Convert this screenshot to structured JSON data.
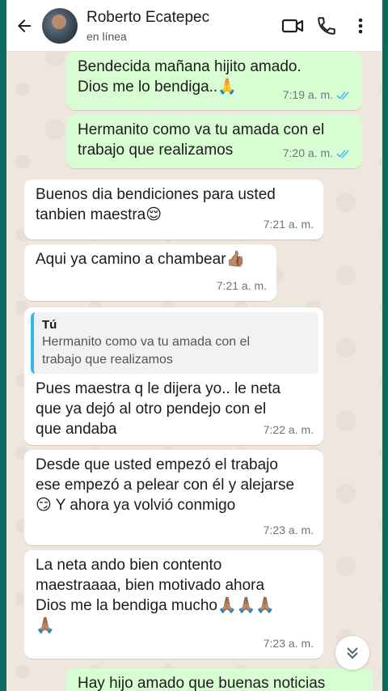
{
  "header": {
    "contact_name": "Roberto Ecatepec",
    "status": "en línea"
  },
  "icons": {
    "back": "arrow-left-icon",
    "video": "video-call-icon",
    "call": "phone-icon",
    "menu": "more-vert-icon",
    "read_receipt": "double-check-icon",
    "scroll_down": "chevron-double-down-icon"
  },
  "colors": {
    "outgoing_bubble": "#d9fdd3",
    "incoming_bubble": "#ffffff",
    "read_tick": "#53bdeb",
    "quote_bar": "#34b7f1"
  },
  "messages": [
    {
      "direction": "out",
      "text": "Bendecida mañana hijito amado.\nDios me lo bendiga..🙏",
      "time": "7:19 a. m.",
      "read": true
    },
    {
      "direction": "out",
      "text": "Hermanito como va tu amada con el\ntrabajo que realizamos",
      "time": "7:20 a. m.",
      "read": true
    },
    {
      "direction": "in",
      "text": "Buenos dia bendiciones para usted\ntanbien maestra😌",
      "time": "7:21 a. m."
    },
    {
      "direction": "in",
      "text": "Aqui ya camino a chambear👍🏽",
      "time": "7:21 a. m."
    },
    {
      "direction": "in",
      "quote_author": "Tú",
      "quote_text": "Hermanito como va tu amada con el\ntrabajo que realizamos",
      "text": "Pues maestra q le dijera yo.. le neta\nque ya dejó al otro pendejo con el\nque andaba",
      "time": "7:22 a. m."
    },
    {
      "direction": "in",
      "text": "Desde que usted empezó el trabajo\nese empezó a pelear con él y alejarse\n😏 Y ahora ya volvió conmigo",
      "time": "7:23 a. m."
    },
    {
      "direction": "in",
      "text": "La neta ando bien contento\nmaestraaaa, bien motivado ahora\nDios me la bendiga mucho🙏🏽🙏🏽🙏🏽\n🙏🏽",
      "time": "7:23 a. m."
    },
    {
      "direction": "out",
      "text": "Hay hijo amado que buenas noticias",
      "time": ""
    }
  ]
}
